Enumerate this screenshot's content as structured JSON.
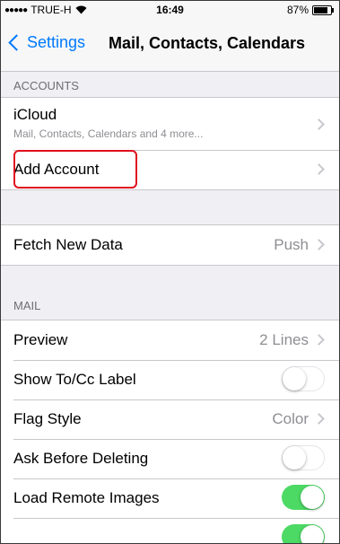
{
  "status_bar": {
    "carrier": "TRUE-H",
    "time": "16:49",
    "battery": "87%"
  },
  "nav": {
    "back_label": "Settings",
    "title": "Mail, Contacts, Calendars"
  },
  "accounts_header": "ACCOUNTS",
  "accounts": {
    "icloud_label": "iCloud",
    "icloud_sub": "Mail, Contacts, Calendars and 4 more...",
    "add_account_label": "Add Account"
  },
  "fetch": {
    "label": "Fetch New Data",
    "value": "Push"
  },
  "mail_header": "MAIL",
  "mail": {
    "preview_label": "Preview",
    "preview_value": "2 Lines",
    "show_tocc_label": "Show To/Cc Label",
    "show_tocc_on": false,
    "flag_style_label": "Flag Style",
    "flag_style_value": "Color",
    "ask_before_deleting_label": "Ask Before Deleting",
    "ask_before_deleting_on": false,
    "load_remote_images_label": "Load Remote Images",
    "load_remote_images_on": true,
    "organize_by_thread_on": true
  },
  "colors": {
    "accent": "#007aff",
    "toggle_on": "#4cd964",
    "highlight": "#e0101e"
  }
}
